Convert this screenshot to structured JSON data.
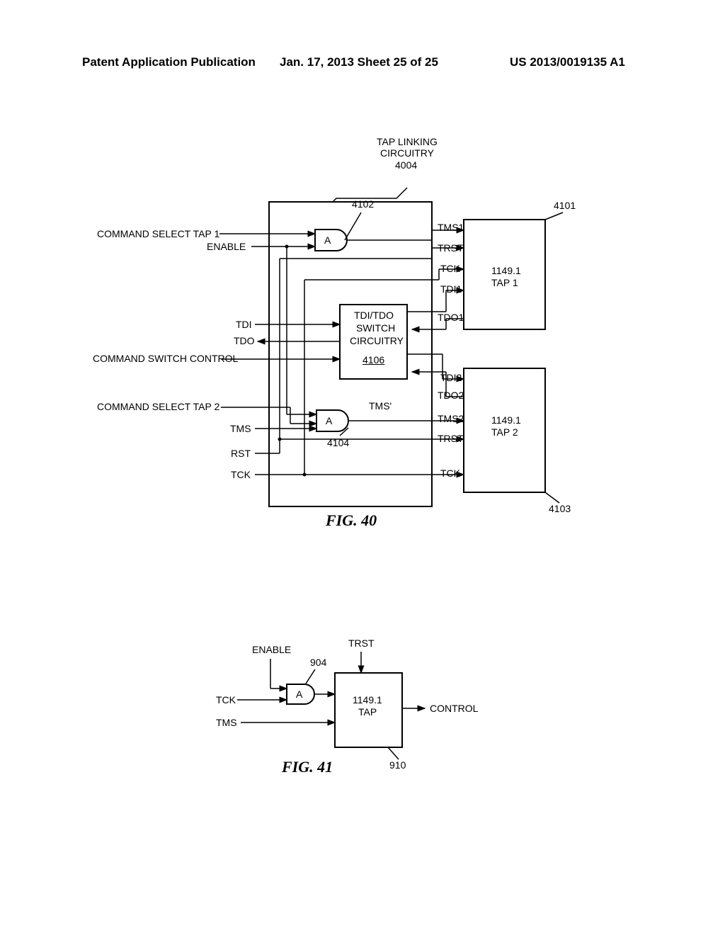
{
  "header": {
    "left": "Patent Application Publication",
    "mid": "Jan. 17, 2013  Sheet 25 of 25",
    "right": "US 2013/0019135 A1"
  },
  "fig40": {
    "title_line1": "TAP LINKING",
    "title_line2": "CIRCUITRY",
    "title_ref": "4004",
    "main_ref": "4102",
    "tap1_ref": "4101",
    "tap1_id": "1149.1",
    "tap1_name": "TAP 1",
    "tap2_ref": "4103",
    "tap2_id": "1149.1",
    "tap2_name": "TAP 2",
    "switch_line1": "TDI/TDO",
    "switch_line2": "SWITCH",
    "switch_line3": "CIRCUITRY",
    "switch_ref": "4106",
    "gate_ref": "4104",
    "gate_label": "A",
    "tms_prime": "TMS'",
    "signals": {
      "cmd_sel_tap1": "COMMAND SELECT TAP 1",
      "enable": "ENABLE",
      "tdi": "TDI",
      "tdo": "TDO",
      "cmd_switch_ctrl": "COMMAND SWITCH CONTROL",
      "cmd_sel_tap2": "COMMAND SELECT TAP 2",
      "tms": "TMS",
      "rst": "RST",
      "tck": "TCK",
      "tms1": "TMS1",
      "trst": "TRST",
      "tdi1": "TDI1",
      "tdo1": "TDO1",
      "tdi2": "TDI2",
      "tdo2": "TDO2",
      "tms2": "TMS2"
    },
    "caption": "FIG. 40"
  },
  "fig41": {
    "enable": "ENABLE",
    "gate_ref": "904",
    "gate_label": "A",
    "tck": "TCK",
    "tms": "TMS",
    "trst": "TRST",
    "block_id": "1149.1",
    "block_name": "TAP",
    "block_ref": "910",
    "control": "CONTROL",
    "caption": "FIG. 41"
  }
}
